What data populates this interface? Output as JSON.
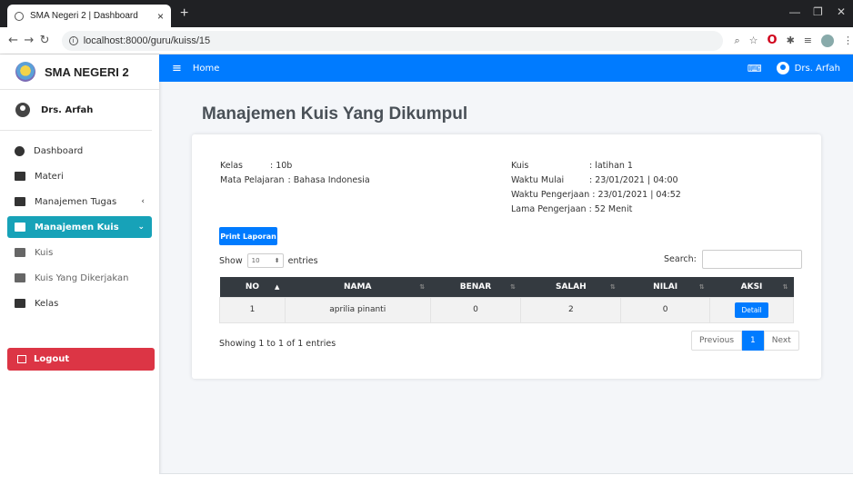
{
  "browser": {
    "tab_title": "SMA Negeri 2 | Dashboard",
    "tab_close": "×",
    "new_tab": "+",
    "url": "localhost:8000/guru/kuiss/15",
    "win_min": "—",
    "win_max": "❐",
    "win_close": "✕"
  },
  "sidebar": {
    "brand": "SMA NEGERI 2",
    "user": "Drs. Arfah",
    "items": [
      {
        "label": "Dashboard",
        "icon": "gauge-icon"
      },
      {
        "label": "Materi",
        "icon": "book-icon"
      },
      {
        "label": "Manajemen Tugas",
        "icon": "book-icon",
        "chevron": "‹"
      },
      {
        "label": "Manajemen Kuis",
        "icon": "book-icon",
        "chevron": "⌄",
        "active": true
      },
      {
        "label": "Kuis",
        "icon": "book-open-icon"
      },
      {
        "label": "Kuis Yang Dikerjakan",
        "icon": "book-open-icon"
      },
      {
        "label": "Kelas",
        "icon": "book-icon"
      }
    ],
    "logout": "Logout"
  },
  "topnav": {
    "home": "Home",
    "user": "Drs. Arfah"
  },
  "page": {
    "title": "Manajemen Kuis Yang Dikumpul"
  },
  "info": {
    "kelas_label": "Kelas",
    "kelas_value": ": 10b",
    "mapel_label": "Mata Pelajaran",
    "mapel_value": ": Bahasa Indonesia",
    "kuis_label": "Kuis",
    "kuis_value": ": latihan 1",
    "mulai_label": "Waktu Mulai",
    "mulai_value": ": 23/01/2021 | 04:00",
    "pengerjaan_label": "Waktu Pengerjaan",
    "pengerjaan_value": ": 23/01/2021 | 04:52",
    "lama_label": "Lama Pengerjaan",
    "lama_value": ": 52 Menit"
  },
  "controls": {
    "print": "Print Laporan",
    "show": "Show",
    "entries_value": "10",
    "entries": "entries",
    "search": "Search:"
  },
  "table": {
    "columns": [
      "NO",
      "NAMA",
      "BENAR",
      "SALAH",
      "NILAI",
      "AKSI"
    ],
    "rows": [
      {
        "no": "1",
        "nama": "aprilia pinanti",
        "benar": "0",
        "salah": "2",
        "nilai": "0",
        "aksi": "Detail"
      }
    ]
  },
  "footer": {
    "showing": "Showing 1 to 1 of 1 entries",
    "previous": "Previous",
    "page": "1",
    "next": "Next"
  },
  "colors": {
    "primary": "#007bff",
    "active_nav": "#17a2b8",
    "logout": "#dc3545",
    "table_head": "#343a40"
  }
}
